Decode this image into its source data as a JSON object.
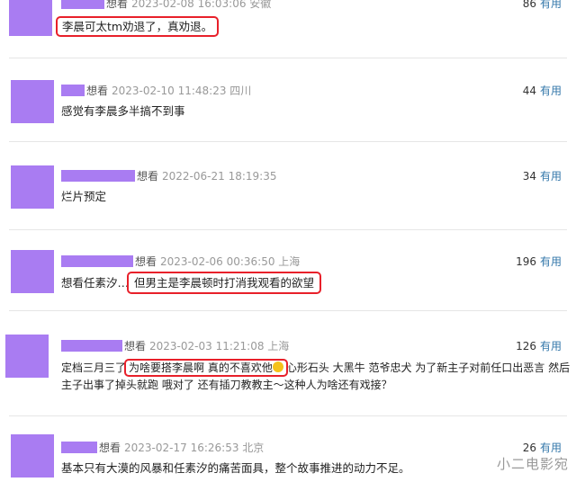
{
  "comments": [
    {
      "rating": "想看",
      "time": "2023-02-08 16:03:06",
      "location": "安徽",
      "count": "86",
      "useful": "有用",
      "text": "李晨可太tm劝退了，真劝退。"
    },
    {
      "rating": "想看",
      "time": "2023-02-10 11:48:23",
      "location": "四川",
      "count": "44",
      "useful": "有用",
      "text": "感觉有李晨多半搞不到事"
    },
    {
      "rating": "想看",
      "time": "2022-06-21 18:19:35",
      "location": "",
      "count": "34",
      "useful": "有用",
      "text": "烂片预定"
    },
    {
      "rating": "想看",
      "time": "2023-02-06 00:36:50",
      "location": "上海",
      "count": "196",
      "useful": "有用",
      "text_a": "想看任素汐…",
      "text_b": "但男主是李晨顿时打消我观看的欲望"
    },
    {
      "rating": "想看",
      "time": "2023-02-03 11:21:08",
      "location": "上海",
      "count": "126",
      "useful": "有用",
      "text_a": "定档三月三了",
      "text_b": "为啥要搭李晨啊 真的不喜欢他",
      "text_c": "心形石头 大黑牛 范爷忠犬 为了新主子对前任口出恶言 然后",
      "text_line2": "主子出事了掉头就跑 哦对了 还有插刀教教主～这种人为啥还有戏接？"
    },
    {
      "rating": "想看",
      "time": "2023-02-17 16:26:53",
      "location": "北京",
      "count": "26",
      "useful": "有用",
      "text": "基本只有大漠的风暴和任素汐的痛苦面具，整个故事推进的动力不足。"
    }
  ],
  "watermark": "小二电影宛"
}
